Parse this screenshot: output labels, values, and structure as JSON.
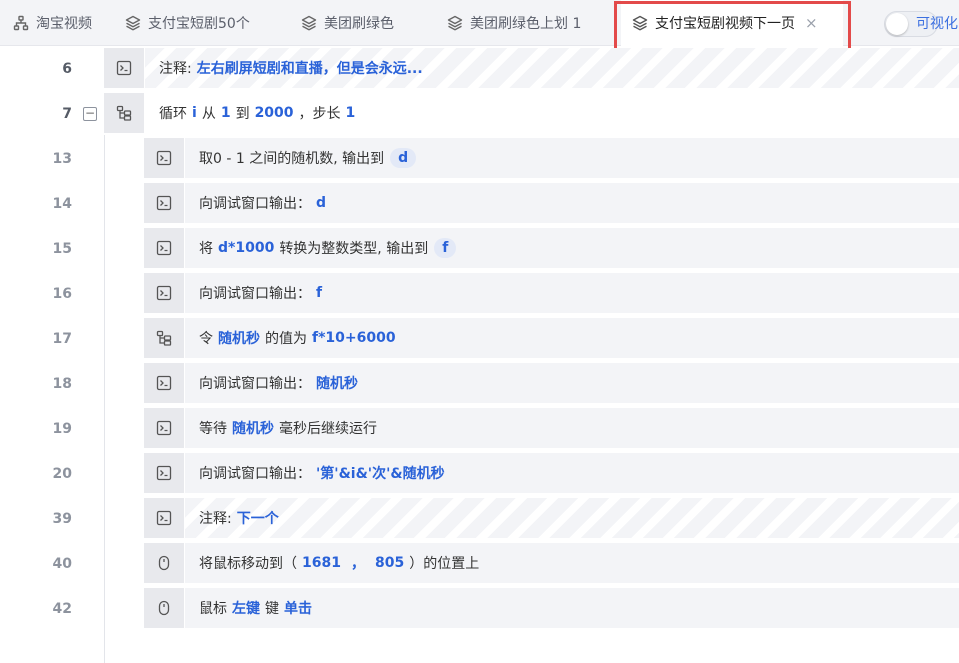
{
  "tabs": [
    {
      "label": "淘宝视频",
      "icon": "sitemap-icon"
    },
    {
      "label": "支付宝短剧50个",
      "icon": "layers-icon"
    },
    {
      "label": "美团刷绿色",
      "icon": "layers-icon"
    },
    {
      "label": "美团刷绿色上划 1",
      "icon": "layers-icon"
    },
    {
      "label": "支付宝短剧视频下一页",
      "icon": "layers-icon",
      "active": true,
      "close": "×"
    }
  ],
  "toggle": {
    "label": "可视化",
    "on": false
  },
  "colors": {
    "accent": "#2a62d8",
    "highlight": "#e34a4a"
  },
  "rows": [
    {
      "line": "6",
      "icon": "terminal-icon",
      "text": "注释:",
      "kw": "左右刷屏短剧和直播，但是会永远..."
    },
    {
      "line": "7",
      "icon": "loop-icon",
      "parts": [
        "循环",
        "i",
        "从",
        "1",
        "到",
        "2000",
        "，步长",
        "1"
      ]
    },
    {
      "line": "13",
      "icon": "terminal-icon",
      "parts": [
        "取0 - 1 之间的随机数, 输出到",
        "d"
      ]
    },
    {
      "line": "14",
      "icon": "terminal-icon",
      "parts": [
        "向调试窗口输出：",
        "d"
      ]
    },
    {
      "line": "15",
      "icon": "terminal-icon",
      "parts": [
        "将",
        "d*1000",
        "转换为整数类型, 输出到",
        "f"
      ]
    },
    {
      "line": "16",
      "icon": "terminal-icon",
      "parts": [
        "向调试窗口输出：",
        "f"
      ]
    },
    {
      "line": "17",
      "icon": "loop-icon",
      "parts": [
        "令",
        "随机秒",
        "的值为",
        "f*10+6000"
      ]
    },
    {
      "line": "18",
      "icon": "terminal-icon",
      "parts": [
        "向调试窗口输出：",
        "随机秒"
      ]
    },
    {
      "line": "19",
      "icon": "terminal-icon",
      "parts": [
        "等待",
        "随机秒",
        "毫秒后继续运行"
      ]
    },
    {
      "line": "20",
      "icon": "terminal-icon",
      "parts": [
        "向调试窗口输出：",
        "'第'&i&'次'&随机秒"
      ]
    },
    {
      "line": "39",
      "icon": "terminal-icon",
      "parts": [
        "注释:",
        "下一个"
      ]
    },
    {
      "line": "40",
      "icon": "mouse-icon",
      "parts": [
        "将鼠标移动到（",
        "1681",
        "，",
        "805",
        "）的位置上"
      ]
    },
    {
      "line": "42",
      "icon": "mouse-icon",
      "parts": [
        "鼠标",
        "左键",
        "键",
        "单击"
      ]
    }
  ]
}
